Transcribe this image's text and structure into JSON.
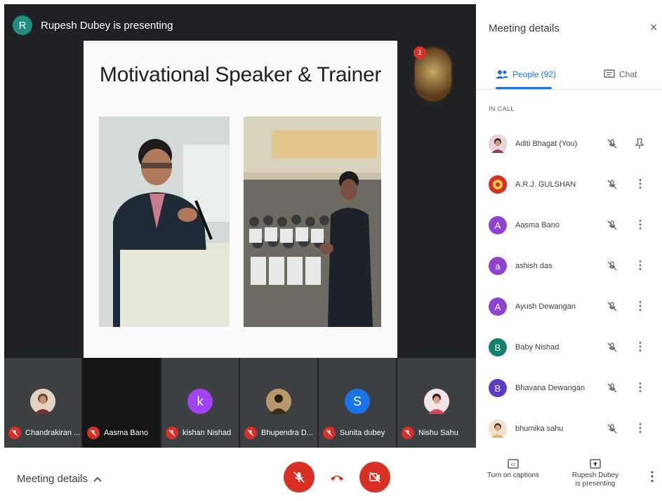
{
  "stage": {
    "presenter_initial": "R",
    "presenter_text": "Rupesh Dubey is presenting",
    "slide_title": "Motivational Speaker & Trainer",
    "pinned_badge": "1"
  },
  "filmstrip": [
    {
      "name": "Chandrakiran ...",
      "avatar": "",
      "color": "#c9a48a",
      "photo": true
    },
    {
      "name": "Aasma Bano",
      "avatar": "",
      "color": "",
      "photo": false,
      "dark": true
    },
    {
      "name": "kishan Nishad",
      "avatar": "k",
      "color": "#a142f4",
      "photo": false
    },
    {
      "name": "Bhupendra D...",
      "avatar": "",
      "color": "#8a6d3b",
      "photo": true
    },
    {
      "name": "Sunita dubey",
      "avatar": "S",
      "color": "#1a73e8",
      "photo": false
    },
    {
      "name": "Nishu Sahu",
      "avatar": "",
      "color": "#e8a0a8",
      "photo": true
    }
  ],
  "panel": {
    "title": "Meeting details",
    "close_icon": "×",
    "tab_people": "People (92)",
    "tab_chat": "Chat",
    "in_call_label": "IN CALL",
    "people": [
      {
        "name": "Aditi Bhagat (You)",
        "avatar": "",
        "color": "#7a4a5a",
        "photo": true,
        "action": "pin"
      },
      {
        "name": "A.R.J. GULSHAN",
        "avatar": "",
        "color": "#d93025",
        "photo": true,
        "action": "more"
      },
      {
        "name": "Aasma Bano",
        "avatar": "A",
        "color": "#8e44d0",
        "photo": false,
        "action": "more"
      },
      {
        "name": "ashish das",
        "avatar": "a",
        "color": "#8e44d0",
        "photo": false,
        "action": "more"
      },
      {
        "name": "Ayush Dewangan",
        "avatar": "A",
        "color": "#8e44d0",
        "photo": false,
        "action": "more"
      },
      {
        "name": "Baby Nishad",
        "avatar": "B",
        "color": "#12806f",
        "photo": false,
        "action": "more"
      },
      {
        "name": "Bhavana Dewangan",
        "avatar": "B",
        "color": "#5b3cc4",
        "photo": false,
        "action": "more"
      },
      {
        "name": "bhumika sahu",
        "avatar": "",
        "color": "#e0b48a",
        "photo": true,
        "action": "more"
      }
    ]
  },
  "bottom": {
    "meeting_details": "Meeting details",
    "captions_label": "Turn on captions",
    "captions_icon": "cc",
    "presenting_label_1": "Rupesh Dubey",
    "presenting_label_2": "is presenting",
    "more_icon": "⋮"
  },
  "colors": {
    "accent": "#1a73e8",
    "danger": "#d93025",
    "stage": "#202124"
  }
}
